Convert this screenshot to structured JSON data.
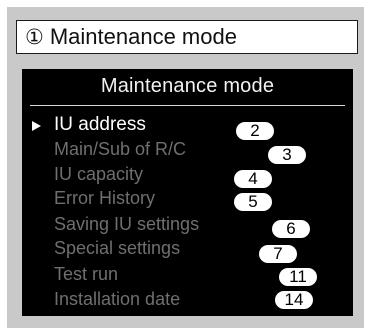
{
  "caption": {
    "number": "①",
    "text": "Maintenance mode"
  },
  "screen": {
    "title": "Maintenance mode",
    "cursor": "▶",
    "items": [
      {
        "label": "IU address",
        "badge": "2",
        "selected": true
      },
      {
        "label": "Main/Sub of R/C",
        "badge": "3",
        "selected": false
      },
      {
        "label": "IU capacity",
        "badge": "4",
        "selected": false
      },
      {
        "label": "Error History",
        "badge": "5",
        "selected": false
      },
      {
        "label": "Saving IU settings",
        "badge": "6",
        "selected": false
      },
      {
        "label": "Special settings",
        "badge": "7",
        "selected": false
      },
      {
        "label": "Test run",
        "badge": "11",
        "selected": false
      },
      {
        "label": "Installation date",
        "badge": "14",
        "selected": false
      }
    ]
  },
  "colors": {
    "frame": "#c9c9c9",
    "screen": "#000000",
    "selected_text": "#ffffff",
    "inactive_text": "#6f6f6f"
  }
}
